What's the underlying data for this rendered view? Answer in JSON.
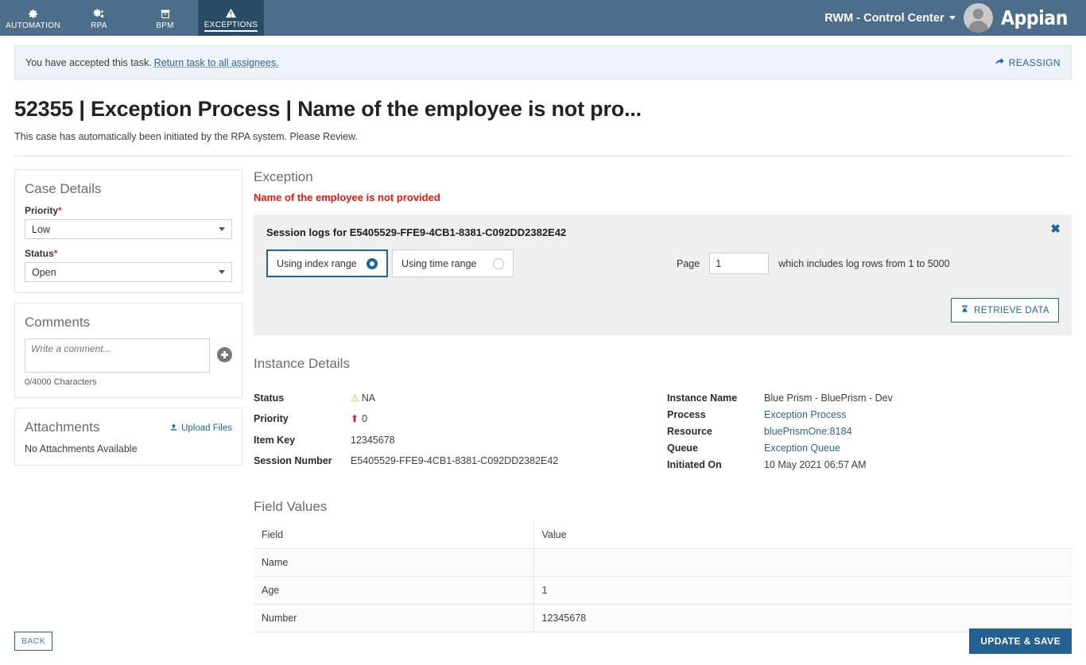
{
  "topnav": {
    "items": [
      {
        "label": "AUTOMATION",
        "icon": "gear-icon",
        "active": false
      },
      {
        "label": "RPA",
        "icon": "gears-icon",
        "active": false
      },
      {
        "label": "BPM",
        "icon": "archive-box-icon",
        "active": false
      },
      {
        "label": "EXCEPTIONS",
        "icon": "warning-triangle-icon",
        "active": true
      }
    ],
    "context_name": "RWM - Control Center",
    "brand": "Appian",
    "bg_color": "#4C6E8A",
    "active_bg_color": "#294B63"
  },
  "banner": {
    "message": "You have accepted this task.",
    "link": "Return task to all assignees.",
    "reassign_label": "REASSIGN",
    "reassign_icon": "share-arrow-icon"
  },
  "header": {
    "title": "52355 | Exception Process | Name of the employee is not pro...",
    "subtitle": "This case has automatically been initiated by the RPA system. Please Review."
  },
  "case_details": {
    "heading": "Case Details",
    "priority_label": "Priority",
    "priority_value": "Low",
    "status_label": "Status",
    "status_value": "Open",
    "required_marker": "*"
  },
  "comments": {
    "heading": "Comments",
    "placeholder": "Write a comment...",
    "value": "",
    "char_count": "0/4000 Characters",
    "add_icon": "plus-circle-icon"
  },
  "attachments": {
    "heading": "Attachments",
    "upload_label": "Upload Files",
    "upload_icon": "upload-icon",
    "empty_text": "No Attachments Available"
  },
  "exception": {
    "heading": "Exception",
    "error_text": "Name of the employee is not provided"
  },
  "session_logs": {
    "title": "Session logs for E5405529-FFE9-4CB1-8381-C092DD2382E42",
    "close_icon": "close-icon",
    "options": [
      {
        "label": "Using index range",
        "selected": true
      },
      {
        "label": "Using time range",
        "selected": false
      }
    ],
    "page_label": "Page",
    "page_value": "1",
    "rows_note": "which includes log rows from 1 to 5000",
    "retrieve_label": "RETRIEVE DATA",
    "retrieve_icon": "hourglass-icon",
    "accent_color": "#1d659c"
  },
  "instance_details": {
    "heading": "Instance Details",
    "left": [
      {
        "key": "Status",
        "value": "NA",
        "icon": "warning-triangle-icon",
        "link": false
      },
      {
        "key": "Priority",
        "value": "0",
        "icon": "up-arrow-icon",
        "link": false
      },
      {
        "key": "Item Key",
        "value": "12345678",
        "icon": "",
        "link": false
      },
      {
        "key": "Session Number",
        "value": "E5405529-FFE9-4CB1-8381-C092DD2382E42",
        "icon": "",
        "link": false
      }
    ],
    "right": [
      {
        "key": "Instance Name",
        "value": "Blue Prism - BluePrism - Dev",
        "link": false
      },
      {
        "key": "Process",
        "value": "Exception Process",
        "link": true
      },
      {
        "key": "Resource",
        "value": "bluePrismOne:8184",
        "link": true
      },
      {
        "key": "Queue",
        "value": "Exception Queue",
        "link": true
      },
      {
        "key": "Initiated On",
        "value": "10 May 2021 06:57 AM",
        "link": false
      }
    ]
  },
  "field_values": {
    "heading": "Field Values",
    "columns": [
      "Field",
      "Value"
    ],
    "rows": [
      {
        "field": "Name",
        "value": ""
      },
      {
        "field": "Age",
        "value": "1"
      },
      {
        "field": "Number",
        "value": "12345678"
      }
    ]
  },
  "footer": {
    "back_label": "BACK",
    "save_label": "UPDATE & SAVE",
    "save_color": "#236192"
  }
}
